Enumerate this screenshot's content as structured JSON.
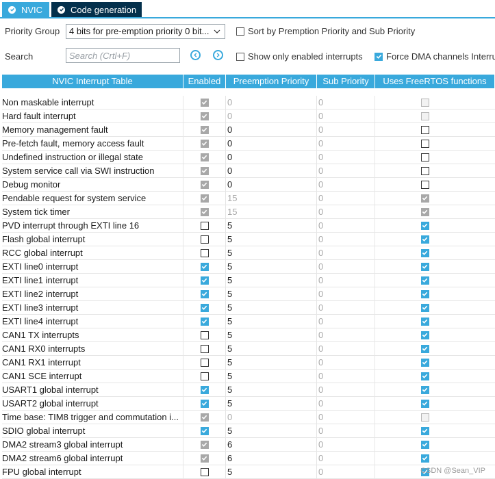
{
  "tabs": [
    {
      "label": "NVIC",
      "icon": "check-circle-icon"
    },
    {
      "label": "Code generation",
      "icon": "check-circle-icon"
    }
  ],
  "controls": {
    "priority_group_label": "Priority Group",
    "priority_group_value": "4 bits for pre-emption priority 0 bit...",
    "search_label": "Search",
    "search_placeholder": "Search (Crtl+F)",
    "sort_label": "Sort by Premption Priority and Sub Priority",
    "sort_checked": false,
    "show_enabled_label": "Show only enabled interrupts",
    "show_enabled_checked": false,
    "force_dma_label": "Force DMA channels Interru",
    "force_dma_checked": true
  },
  "table": {
    "headers": [
      "NVIC Interrupt Table",
      "Enabled",
      "Preemption Priority",
      "Sub Priority",
      "Uses FreeRTOS functions"
    ],
    "rows": [
      {
        "name": "Non maskable interrupt",
        "enabled": "gray",
        "pre": "0",
        "sub": "0",
        "rtos": "grayempty",
        "dim": true
      },
      {
        "name": "Hard fault interrupt",
        "enabled": "gray",
        "pre": "0",
        "sub": "0",
        "rtos": "grayempty",
        "dim": true
      },
      {
        "name": "Memory management fault",
        "enabled": "gray",
        "pre": "0",
        "sub": "0",
        "rtos": "off",
        "dim": false
      },
      {
        "name": "Pre-fetch fault, memory access fault",
        "enabled": "gray",
        "pre": "0",
        "sub": "0",
        "rtos": "off",
        "dim": false
      },
      {
        "name": "Undefined instruction or illegal state",
        "enabled": "gray",
        "pre": "0",
        "sub": "0",
        "rtos": "off",
        "dim": false
      },
      {
        "name": "System service call via SWI instruction",
        "enabled": "gray",
        "pre": "0",
        "sub": "0",
        "rtos": "off",
        "dim": false
      },
      {
        "name": "Debug monitor",
        "enabled": "gray",
        "pre": "0",
        "sub": "0",
        "rtos": "off",
        "dim": false
      },
      {
        "name": "Pendable request for system service",
        "enabled": "gray",
        "pre": "15",
        "sub": "0",
        "rtos": "gray",
        "dim": true
      },
      {
        "name": "System tick timer",
        "enabled": "gray",
        "pre": "15",
        "sub": "0",
        "rtos": "gray",
        "dim": true
      },
      {
        "name": "PVD interrupt through EXTI line 16",
        "enabled": "off",
        "pre": "5",
        "sub": "0",
        "rtos": "on",
        "dim": false
      },
      {
        "name": "Flash global interrupt",
        "enabled": "off",
        "pre": "5",
        "sub": "0",
        "rtos": "on",
        "dim": false
      },
      {
        "name": "RCC global interrupt",
        "enabled": "off",
        "pre": "5",
        "sub": "0",
        "rtos": "on",
        "dim": false
      },
      {
        "name": "EXTI line0 interrupt",
        "enabled": "on",
        "pre": "5",
        "sub": "0",
        "rtos": "on",
        "dim": false
      },
      {
        "name": "EXTI line1 interrupt",
        "enabled": "on",
        "pre": "5",
        "sub": "0",
        "rtos": "on",
        "dim": false
      },
      {
        "name": "EXTI line2 interrupt",
        "enabled": "on",
        "pre": "5",
        "sub": "0",
        "rtos": "on",
        "dim": false
      },
      {
        "name": "EXTI line3 interrupt",
        "enabled": "on",
        "pre": "5",
        "sub": "0",
        "rtos": "on",
        "dim": false
      },
      {
        "name": "EXTI line4 interrupt",
        "enabled": "on",
        "pre": "5",
        "sub": "0",
        "rtos": "on",
        "dim": false
      },
      {
        "name": "CAN1 TX interrupts",
        "enabled": "off",
        "pre": "5",
        "sub": "0",
        "rtos": "on",
        "dim": false
      },
      {
        "name": "CAN1 RX0 interrupts",
        "enabled": "off",
        "pre": "5",
        "sub": "0",
        "rtos": "on",
        "dim": false
      },
      {
        "name": "CAN1 RX1 interrupt",
        "enabled": "off",
        "pre": "5",
        "sub": "0",
        "rtos": "on",
        "dim": false
      },
      {
        "name": "CAN1 SCE interrupt",
        "enabled": "off",
        "pre": "5",
        "sub": "0",
        "rtos": "on",
        "dim": false
      },
      {
        "name": "USART1 global interrupt",
        "enabled": "on",
        "pre": "5",
        "sub": "0",
        "rtos": "on",
        "dim": false
      },
      {
        "name": "USART2 global interrupt",
        "enabled": "on",
        "pre": "5",
        "sub": "0",
        "rtos": "on",
        "dim": false
      },
      {
        "name": "Time base: TIM8 trigger and commutation i...",
        "enabled": "gray",
        "pre": "0",
        "sub": "0",
        "rtos": "grayempty",
        "dim": true
      },
      {
        "name": "SDIO global interrupt",
        "enabled": "on",
        "pre": "5",
        "sub": "0",
        "rtos": "on",
        "dim": false
      },
      {
        "name": "DMA2 stream3 global interrupt",
        "enabled": "gray",
        "pre": "6",
        "sub": "0",
        "rtos": "on",
        "dim": false
      },
      {
        "name": "DMA2 stream6 global interrupt",
        "enabled": "gray",
        "pre": "6",
        "sub": "0",
        "rtos": "on",
        "dim": false
      },
      {
        "name": "FPU global interrupt",
        "enabled": "off",
        "pre": "5",
        "sub": "0",
        "rtos": "on",
        "dim": false
      }
    ]
  },
  "watermark": "CSDN @Sean_VIP",
  "colors": {
    "accent": "#39a9dc",
    "dark_tab": "#04304c",
    "disabled": "#a8a8a8"
  }
}
